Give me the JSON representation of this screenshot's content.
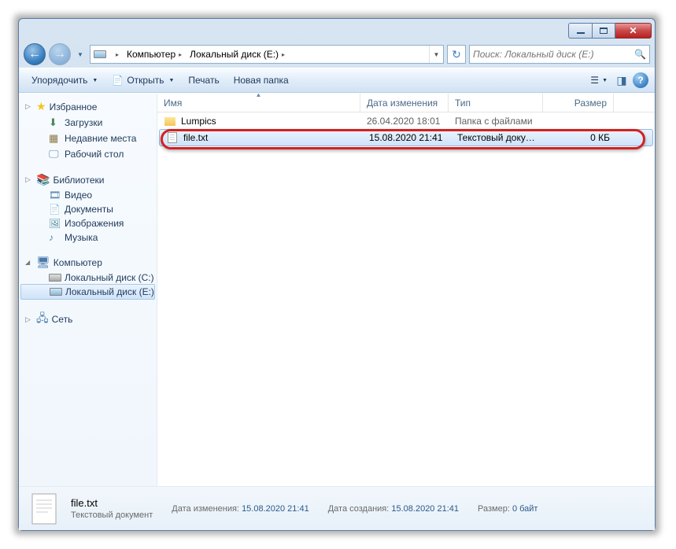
{
  "titlebar": {
    "minimize": "_",
    "maximize": "□",
    "close": "✕"
  },
  "navbar": {
    "back": "←",
    "forward": "→"
  },
  "breadcrumb": {
    "root_chevron": "▸",
    "level0": "Компьютер",
    "level1": "Локальный диск (E:)"
  },
  "refresh": "↻",
  "search": {
    "placeholder": "Поиск: Локальный диск (E:)"
  },
  "toolbar": {
    "organize": "Упорядочить",
    "open": "Открыть",
    "print": "Печать",
    "newfolder": "Новая папка"
  },
  "sidebar": {
    "favorites": {
      "label": "Избранное",
      "items": [
        {
          "label": "Загрузки",
          "icon": "downloads"
        },
        {
          "label": "Недавние места",
          "icon": "recent"
        },
        {
          "label": "Рабочий стол",
          "icon": "desktop"
        }
      ]
    },
    "libraries": {
      "label": "Библиотеки",
      "items": [
        {
          "label": "Видео",
          "icon": "video"
        },
        {
          "label": "Документы",
          "icon": "docs"
        },
        {
          "label": "Изображения",
          "icon": "pics"
        },
        {
          "label": "Музыка",
          "icon": "music"
        }
      ]
    },
    "computer": {
      "label": "Компьютер",
      "items": [
        {
          "label": "Локальный диск (C:)",
          "selected": false
        },
        {
          "label": "Локальный диск (E:)",
          "selected": true
        }
      ]
    },
    "network": {
      "label": "Сеть"
    }
  },
  "columns": {
    "name": "Имя",
    "date": "Дата изменения",
    "type": "Тип",
    "size": "Размер"
  },
  "files": [
    {
      "name": "Lumpics",
      "date": "26.04.2020 18:01",
      "type": "Папка с файлами",
      "size": "",
      "icon": "folder",
      "selected": false
    },
    {
      "name": "file.txt",
      "date": "15.08.2020 21:41",
      "type": "Текстовый докум...",
      "size": "0 КБ",
      "icon": "doc",
      "selected": true
    }
  ],
  "details": {
    "name": "file.txt",
    "type": "Текстовый документ",
    "modified_label": "Дата изменения:",
    "modified_value": "15.08.2020 21:41",
    "created_label": "Дата создания:",
    "created_value": "15.08.2020 21:41",
    "size_label": "Размер:",
    "size_value": "0 байт"
  }
}
